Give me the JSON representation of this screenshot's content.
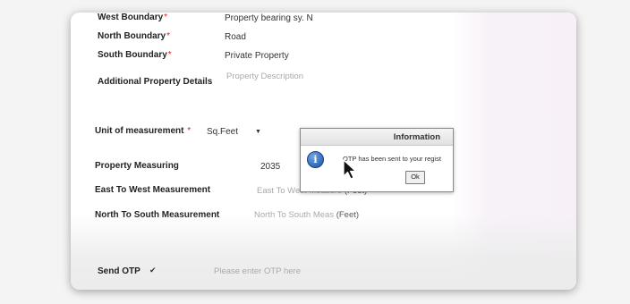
{
  "form": {
    "west_boundary": {
      "label": "West Boundary",
      "value": "Property bearing sy. N"
    },
    "north_boundary": {
      "label": "North Boundary",
      "value": "Road"
    },
    "south_boundary": {
      "label": "South Boundary",
      "value": "Private Property"
    },
    "additional_details": {
      "label": "Additional Property Details",
      "placeholder": "Property Description"
    },
    "unit_of_measurement": {
      "label": "Unit of measurement",
      "value": "Sq.Feet"
    },
    "property_measuring": {
      "label": "Property Measuring",
      "value": "2035"
    },
    "east_west": {
      "label": "East To West Measurement",
      "placeholder": "East To West Measure",
      "unit": "(Feet)"
    },
    "north_south": {
      "label": "North To South Measurement",
      "placeholder": "North To South Meas",
      "unit": "(Feet)"
    },
    "send_otp": {
      "label": "Send OTP",
      "placeholder": "Please enter OTP here"
    },
    "required_mark": "*"
  },
  "dialog": {
    "title": "Information",
    "message": "OTP has been sent to your regist",
    "ok_label": "Ok",
    "icon": "info-icon"
  },
  "colors": {
    "required": "#d22222",
    "placeholder": "#a9a9a9"
  }
}
